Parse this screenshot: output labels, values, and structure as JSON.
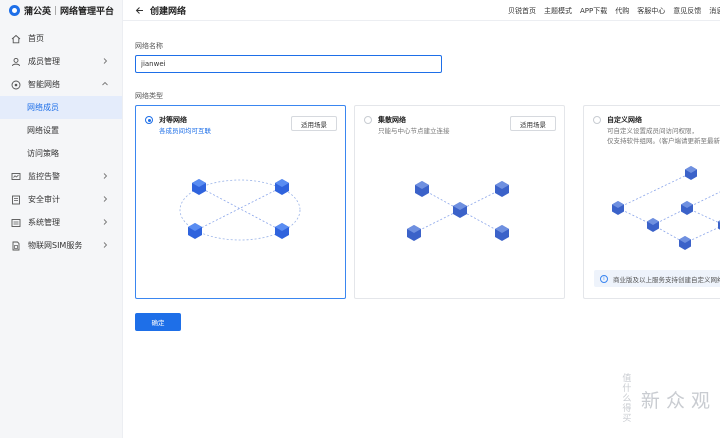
{
  "brand": {
    "name": "蒲公英",
    "platform": "网络管理平台"
  },
  "sidebar": {
    "items": [
      {
        "label": "首页",
        "icon": "home-icon"
      },
      {
        "label": "成员管理",
        "icon": "user-icon",
        "expandable": true
      },
      {
        "label": "智能网络",
        "icon": "network-icon",
        "expanded": true,
        "children": [
          {
            "label": "网络成员",
            "active": true
          },
          {
            "label": "网络设置"
          },
          {
            "label": "访问策略"
          }
        ]
      },
      {
        "label": "监控告警",
        "icon": "monitor-icon",
        "expandable": true
      },
      {
        "label": "安全审计",
        "icon": "audit-icon",
        "expandable": true
      },
      {
        "label": "系统管理",
        "icon": "settings-icon",
        "expandable": true
      },
      {
        "label": "物联网SIM服务",
        "icon": "sim-icon",
        "expandable": true
      }
    ]
  },
  "header": {
    "title": "创建网络",
    "links": [
      "贝锐首页",
      "主题模式",
      "APP下载",
      "代购",
      "客服中心",
      "意见反馈",
      "消息"
    ]
  },
  "form": {
    "name_label": "网络名称",
    "name_value": "jianwei",
    "type_label": "网络类型",
    "confirm_label": "确定"
  },
  "network_types": [
    {
      "title": "对等网络",
      "desc": [
        "各成员间均可互联"
      ],
      "button": "适用场景",
      "selected": true
    },
    {
      "title": "集散网络",
      "desc": [
        "只能与中心节点建立连接"
      ],
      "button": "适用场景",
      "selected": false
    },
    {
      "title": "自定义网络",
      "desc": [
        "可自定义设置成员间访问权限，",
        "仅支持软件组网。(客户端请更新至最新版本)"
      ],
      "selected": false,
      "notice": "商业版及以上服务支持创建自定义网络"
    }
  ],
  "watermark": {
    "badge": "值 什么 得买",
    "text": "新 众 观"
  },
  "colors": {
    "accent": "#1e6fe8",
    "node": "#3a6fe0",
    "sidebar_bg": "#f5f6f8",
    "active_bg": "#e4ecfb"
  }
}
